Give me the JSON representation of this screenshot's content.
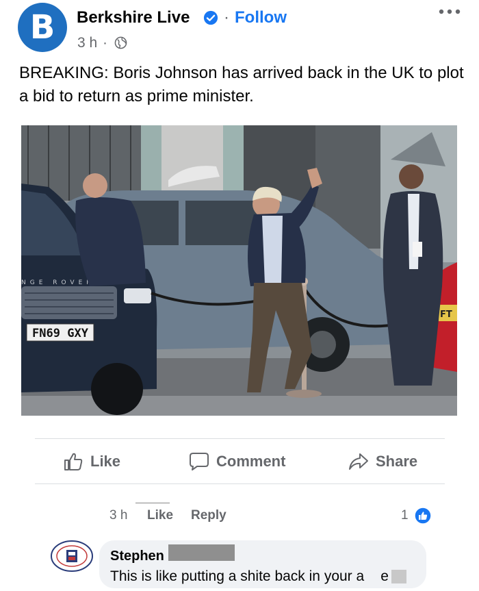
{
  "post": {
    "page_name": "Berkshire Live",
    "logo_letter": "B",
    "separator": "·",
    "follow_label": "Follow",
    "time": "3 h",
    "time_separator": "·",
    "text": "BREAKING: Boris Johnson has arrived back in the UK to plot a bid to return as prime minister.",
    "license_plate": "FN69 GXY",
    "car_badge": "NGE ROVER",
    "rear_plate": "FT"
  },
  "actions": {
    "like": "Like",
    "comment": "Comment",
    "share": "Share"
  },
  "comment": {
    "time": "3 h",
    "like": "Like",
    "reply": "Reply",
    "reactions": "1",
    "author": "Stephen",
    "text_before": "This is like putting a shite back in your a",
    "text_after": "e"
  },
  "colors": {
    "brand_blue": "#1877f2",
    "logo_blue": "#1f6fc0",
    "muted": "#65676b",
    "bubble": "#f0f2f5"
  },
  "icons": [
    "verified-icon",
    "globe-icon",
    "more-icon",
    "like-icon",
    "comment-icon",
    "share-icon",
    "like-badge-icon"
  ]
}
